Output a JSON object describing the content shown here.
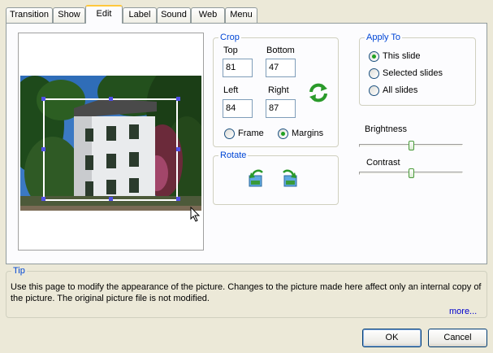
{
  "tabs": [
    "Transition",
    "Show",
    "Edit",
    "Label",
    "Sound",
    "Web",
    "Menu"
  ],
  "active_tab": "Edit",
  "crop": {
    "legend": "Crop",
    "top_label": "Top",
    "top_value": "81",
    "bottom_label": "Bottom",
    "bottom_value": "47",
    "left_label": "Left",
    "left_value": "84",
    "right_label": "Right",
    "right_value": "87",
    "frame_label": "Frame",
    "margins_label": "Margins",
    "selected_mode": "Margins"
  },
  "rotate": {
    "legend": "Rotate"
  },
  "apply_to": {
    "legend": "Apply To",
    "options": [
      "This slide",
      "Selected slides",
      "All slides"
    ],
    "selected": "This slide"
  },
  "brightness": {
    "label": "Brightness",
    "level_percent": 50
  },
  "contrast": {
    "label": "Contrast",
    "level_percent": 50
  },
  "tip": {
    "legend": "Tip",
    "text": "Use this page to modify the appearance of the picture. Changes to the picture made here affect only an internal copy of the picture. The original picture file is not modified.",
    "more_link": "more..."
  },
  "buttons": {
    "ok": "OK",
    "cancel": "Cancel"
  },
  "colors": {
    "legend_blue": "#0046d5",
    "link_blue": "#0000cc",
    "accent_green": "#21a121"
  },
  "icons": {
    "reset_crop": "refresh-arrows-icon",
    "rotate_left": "rotate-left-icon",
    "rotate_right": "rotate-right-icon",
    "cursor": "mouse-pointer-icon"
  }
}
